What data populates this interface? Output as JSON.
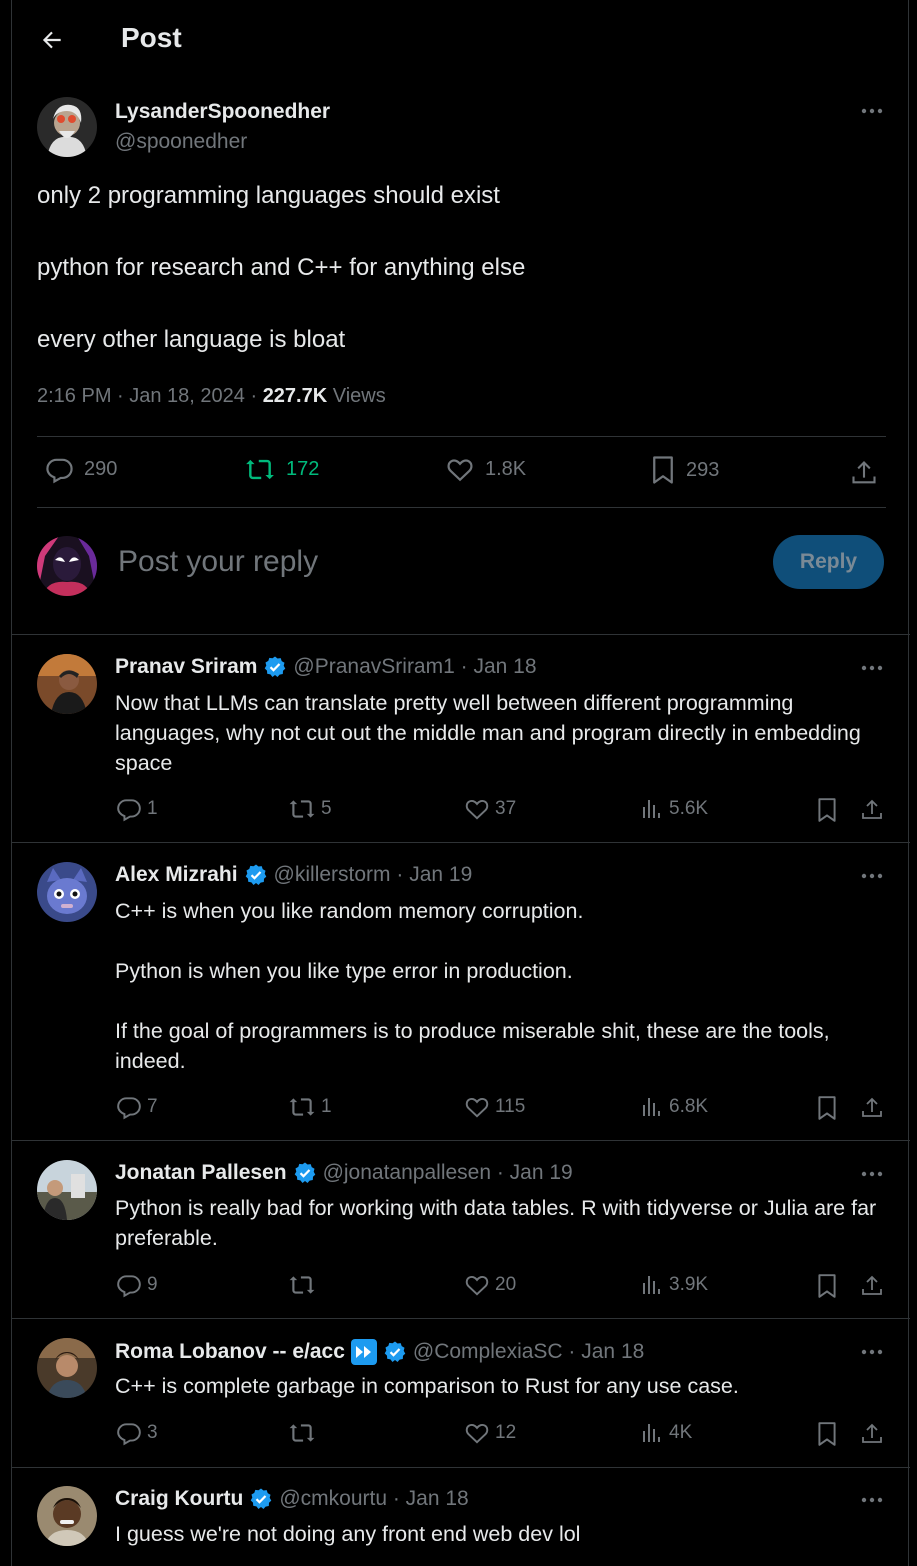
{
  "header": {
    "title": "Post"
  },
  "post": {
    "author_name": "LysanderSpoonedher",
    "author_handle": "@spoonedher",
    "lines": [
      "only 2 programming languages should exist",
      "python for research and C++ for anything else",
      "every other language is bloat"
    ],
    "time": "2:16 PM · Jan 18, 2024 · ",
    "views_count": "227.7K",
    "views_label": " Views",
    "stats": {
      "replies": "290",
      "reposts": "172",
      "likes": "1.8K",
      "bookmarks": "293"
    }
  },
  "reply_box": {
    "placeholder": "Post your reply",
    "button": "Reply"
  },
  "replies": [
    {
      "name": "Pranav Sriram",
      "handle_date": "@PranavSriram1 · Jan 18",
      "paragraphs": [
        "Now that LLMs can translate pretty well between different programming languages, why not cut out the middle man and program directly in embedding space"
      ],
      "replies": "1",
      "reposts": "5",
      "likes": "37",
      "views": "5.6K"
    },
    {
      "name": "Alex Mizrahi",
      "handle_date": "@killerstorm · Jan 19",
      "paragraphs": [
        "C++ is when you like random memory corruption.",
        "Python is when you like type error in production.",
        "If the goal of programmers is to produce miserable shit, these are the tools, indeed."
      ],
      "replies": "7",
      "reposts": "1",
      "likes": "115",
      "views": "6.8K"
    },
    {
      "name": "Jonatan Pallesen",
      "handle_date": "@jonatanpallesen · Jan 19",
      "paragraphs": [
        "Python is really bad for working with data tables. R with tidyverse or Julia are far preferable."
      ],
      "replies": "9",
      "reposts": "",
      "likes": "20",
      "views": "3.9K"
    },
    {
      "name": "Roma Lobanov -- e/acc",
      "handle_date": "@ComplexiaSC · Jan 18",
      "paragraphs": [
        "C++ is complete garbage in comparison to Rust for any use case."
      ],
      "replies": "3",
      "reposts": "",
      "likes": "12",
      "views": "4K"
    },
    {
      "name": "Craig Kourtu",
      "handle_date": "@cmkourtu · Jan 18",
      "paragraphs": [
        "I guess we're not doing any front end web dev lol"
      ]
    }
  ],
  "colors": {
    "accent": "#1d9bf0",
    "repost_active": "#00ba7c",
    "muted": "#71767b",
    "reply_button": "#0f4e79"
  },
  "icons": [
    "back-arrow-icon",
    "more-icon",
    "comment-icon",
    "repost-icon",
    "heart-icon",
    "bookmark-icon",
    "share-icon",
    "views-icon",
    "verified-icon",
    "fast-forward-icon"
  ]
}
